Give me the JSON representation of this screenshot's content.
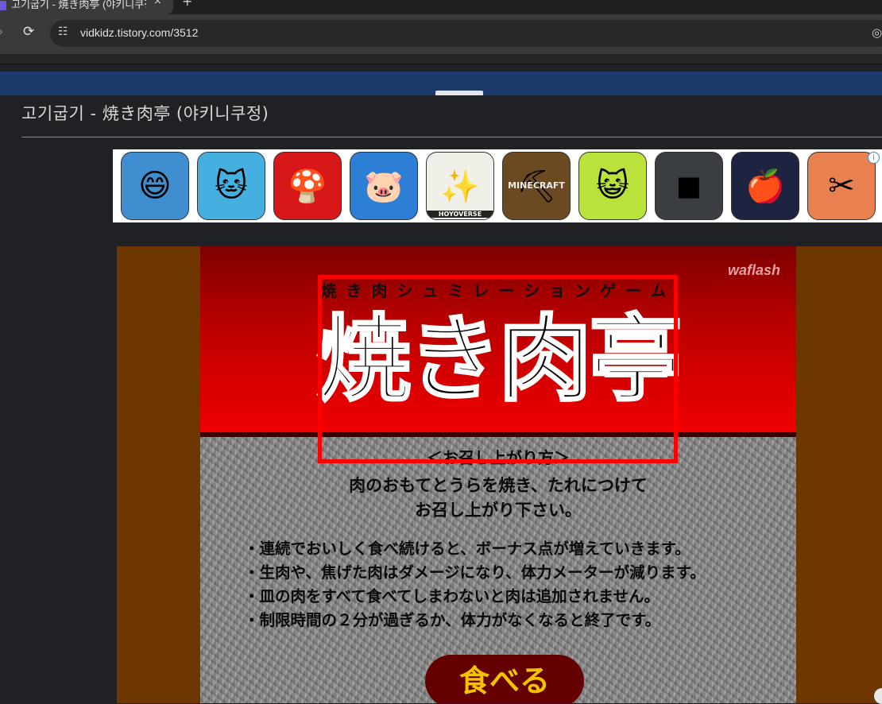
{
  "browser": {
    "tab_title": "고기굽기 - 焼き肉亭 (야키니쿠정)",
    "tab_close": "×",
    "new_tab": "+",
    "url": "vidkidz.tistory.com/3512"
  },
  "post": {
    "title": "고기굽기 - 焼き肉亭 (야키니쿠정)"
  },
  "ad": {
    "apps": [
      {
        "name": "jinx-icon",
        "glyph": "😄",
        "bg": "#3f8fd0"
      },
      {
        "name": "talking-tom-gold-run-icon",
        "glyph": "🐱",
        "bg": "#45b0e0"
      },
      {
        "name": "super-mario-icon",
        "glyph": "🍄",
        "bg": "#d81818"
      },
      {
        "name": "piggy-icon",
        "glyph": "🐷",
        "bg": "#2c7fd4"
      },
      {
        "name": "hoyoverse-icon",
        "glyph": "✨",
        "bg": "#f0efe8"
      },
      {
        "name": "minecraft-icon",
        "glyph": "⛏",
        "bg": "#6b4a22"
      },
      {
        "name": "talking-tom-icon",
        "glyph": "😺",
        "bg": "#b9e23a"
      },
      {
        "name": "roblox-icon",
        "glyph": "◼",
        "bg": "#3a3d42"
      },
      {
        "name": "snow-white-icon",
        "glyph": "🍎",
        "bg": "#1d2340"
      },
      {
        "name": "makeover-icon",
        "glyph": "✂",
        "bg": "#e88050"
      }
    ],
    "hoyoverse_caption": "HOYOVERSE",
    "minecraft_caption": "MINECRAFT",
    "info_glyph": "i"
  },
  "game": {
    "brand": "waflash",
    "subtitle": "焼き肉シュミレーションゲーム",
    "title": "焼き肉亭",
    "howto_heading": "＜お召し上がり方＞",
    "howto_lines": [
      "肉のおもてとうらを焼き、たれにつけて",
      "お召し上がり下さい。"
    ],
    "rules": [
      "・連続でおいしく食べ続けると、ボーナス点が増えていきます。",
      "・生肉や、焦げた肉はダメージになり、体力メーターが減ります。",
      "・皿の肉をすべて食べてしまわないと肉は追加されません。",
      "・制限時間の２分が過ぎるか、体力がなくなると終了です。"
    ],
    "start_button": "食べる"
  }
}
